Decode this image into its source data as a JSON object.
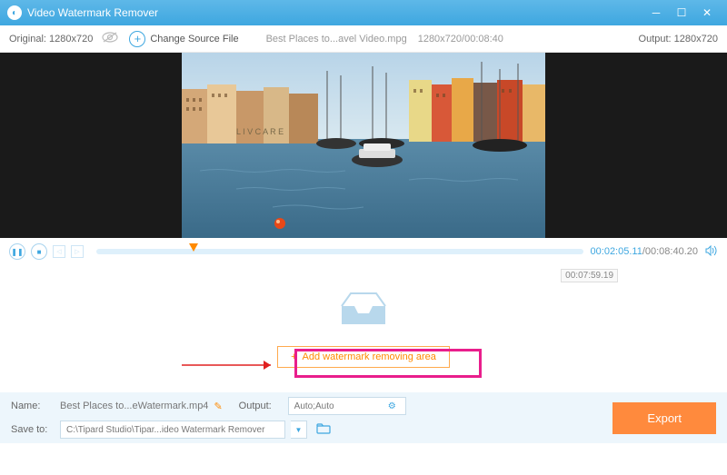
{
  "titlebar": {
    "title": "Video Watermark Remover"
  },
  "toolbar": {
    "original_label": "Original:",
    "original_res": "1280x720",
    "change_src": "Change Source File",
    "filename": "Best Places to...avel Video.mpg",
    "resolution_time": "1280x720/00:08:40",
    "output_label": "Output:",
    "output_res": "1280x720"
  },
  "player": {
    "current_time": "00:02:05.11",
    "total_time": "/00:08:40.20",
    "tooltip": "00:07:59.19"
  },
  "main": {
    "add_btn_label": "Add watermark removing area"
  },
  "bottom": {
    "name_label": "Name:",
    "name_value": "Best Places to...eWatermark.mp4",
    "output_label": "Output:",
    "output_value": "Auto;Auto",
    "save_label": "Save to:",
    "save_value": "C:\\Tipard Studio\\Tipar...ideo Watermark Remover",
    "export_label": "Export"
  }
}
